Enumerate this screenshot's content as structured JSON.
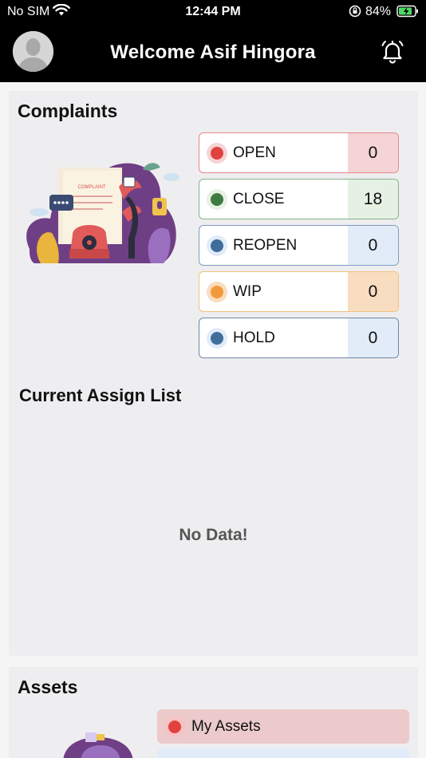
{
  "status_bar": {
    "carrier": "No SIM",
    "time": "12:44 PM",
    "battery": "84%"
  },
  "header": {
    "title": "Welcome Asif Hingora",
    "icons": {
      "avatar": "user-avatar",
      "notifications": "bell-icon"
    }
  },
  "complaints": {
    "title": "Complaints",
    "illustration_text": "COMPLAINT",
    "statuses": [
      {
        "label": "OPEN",
        "count": "0",
        "dot_color": "#e0423f",
        "border_color": "#e8878a",
        "count_bg": "#f5d4d5"
      },
      {
        "label": "CLOSE",
        "count": "18",
        "dot_color": "#3f7a44",
        "border_color": "#86b28b",
        "count_bg": "#e6f1e4"
      },
      {
        "label": "REOPEN",
        "count": "0",
        "dot_color": "#3f6d9c",
        "border_color": "#7f9cc2",
        "count_bg": "#e1ecf8"
      },
      {
        "label": "WIP",
        "count": "0",
        "dot_color": "#f19a3a",
        "border_color": "#f2c27d",
        "count_bg": "#f9ddc0"
      },
      {
        "label": "HOLD",
        "count": "0",
        "dot_color": "#3f6d9c",
        "border_color": "#6e87a8",
        "count_bg": "#e1ecf8"
      }
    ]
  },
  "assign_list": {
    "title": "Current Assign List",
    "empty_text": "No Data!"
  },
  "assets": {
    "title": "Assets",
    "items": [
      {
        "label": "My Assets"
      }
    ]
  }
}
